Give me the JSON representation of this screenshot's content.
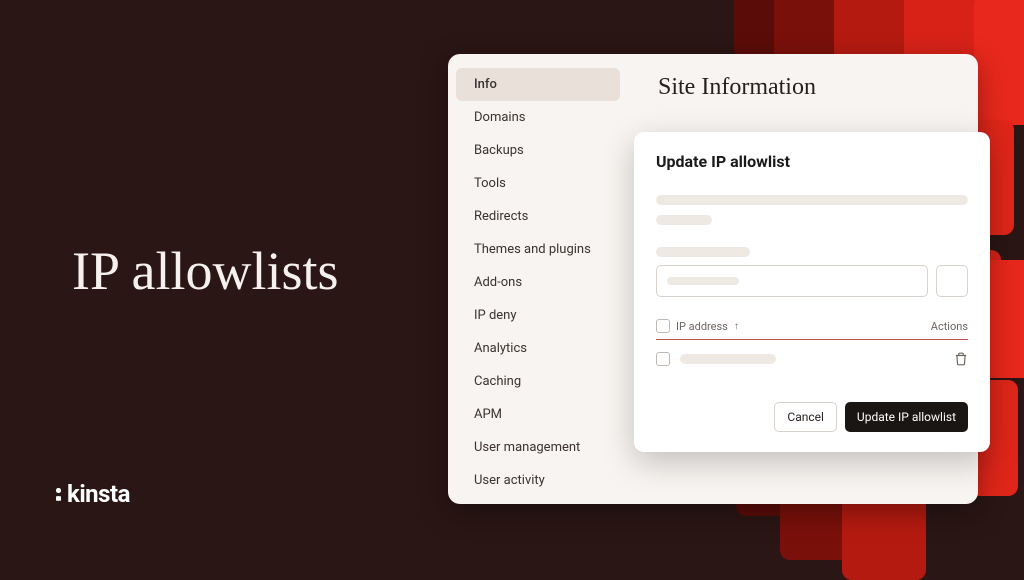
{
  "headline": "IP allowlists",
  "logo": "kinsta",
  "sidebar": {
    "items": [
      {
        "label": "Info",
        "active": true
      },
      {
        "label": "Domains"
      },
      {
        "label": "Backups"
      },
      {
        "label": "Tools"
      },
      {
        "label": "Redirects"
      },
      {
        "label": "Themes and plugins"
      },
      {
        "label": "Add-ons"
      },
      {
        "label": "IP deny"
      },
      {
        "label": "Analytics"
      },
      {
        "label": "Caching"
      },
      {
        "label": "APM"
      },
      {
        "label": "User management"
      },
      {
        "label": "User activity"
      }
    ]
  },
  "page_title": "Site Information",
  "modal": {
    "title": "Update IP allowlist",
    "table": {
      "col_ip": "IP address",
      "col_actions": "Actions"
    },
    "cancel": "Cancel",
    "submit": "Update IP allowlist"
  }
}
